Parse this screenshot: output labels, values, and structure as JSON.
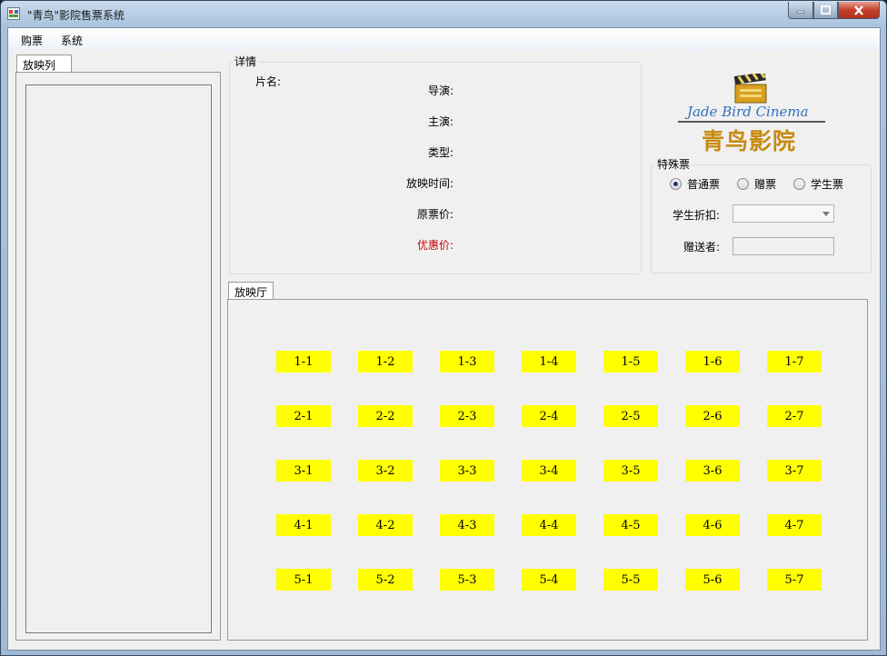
{
  "window": {
    "title": "\"青鸟\"影院售票系统"
  },
  "menu": {
    "items": [
      "购票",
      "系统"
    ]
  },
  "left_panel": {
    "tab_label": "放映列表"
  },
  "details": {
    "group_title": "详情",
    "movie_name_label": "片名:",
    "director_label": "导演:",
    "actor_label": "主演:",
    "type_label": "类型:",
    "showtime_label": "放映时间:",
    "original_price_label": "原票价:",
    "discount_price_label": "优惠价:"
  },
  "logo": {
    "english": "Jade Bird Cinema",
    "chinese": "青鸟影院"
  },
  "special_ticket": {
    "group_title": "特殊票",
    "options": [
      {
        "label": "普通票",
        "checked": true
      },
      {
        "label": "赠票",
        "checked": false
      },
      {
        "label": "学生票",
        "checked": false
      }
    ],
    "student_discount_label": "学生折扣:",
    "student_discount_value": "",
    "giver_label": "赠送者:",
    "giver_value": ""
  },
  "hall": {
    "tab_label": "放映厅",
    "rows": [
      [
        "1-1",
        "1-2",
        "1-3",
        "1-4",
        "1-5",
        "1-6",
        "1-7"
      ],
      [
        "2-1",
        "2-2",
        "2-3",
        "2-4",
        "2-5",
        "2-6",
        "2-7"
      ],
      [
        "3-1",
        "3-2",
        "3-3",
        "3-4",
        "3-5",
        "3-6",
        "3-7"
      ],
      [
        "4-1",
        "4-2",
        "4-3",
        "4-4",
        "4-5",
        "4-6",
        "4-7"
      ],
      [
        "5-1",
        "5-2",
        "5-3",
        "5-4",
        "5-5",
        "5-6",
        "5-7"
      ]
    ],
    "seat_color": "#ffff00"
  },
  "colors": {
    "discount_label": "#cc0000"
  }
}
